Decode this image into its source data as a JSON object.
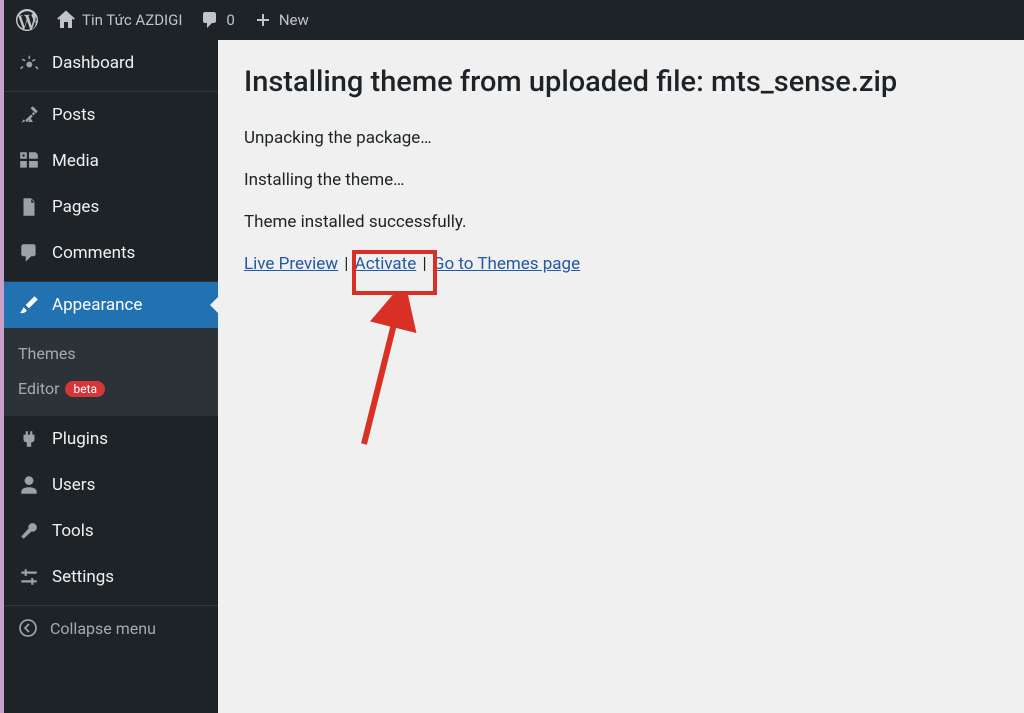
{
  "adminbar": {
    "site_name": "Tin Tức AZDIGI",
    "comments_count": "0",
    "new_label": "New"
  },
  "sidebar": {
    "dashboard": "Dashboard",
    "posts": "Posts",
    "media": "Media",
    "pages": "Pages",
    "comments": "Comments",
    "appearance": "Appearance",
    "appearance_sub": {
      "themes": "Themes",
      "editor": "Editor",
      "editor_badge": "beta"
    },
    "plugins": "Plugins",
    "users": "Users",
    "tools": "Tools",
    "settings": "Settings",
    "collapse": "Collapse menu"
  },
  "main": {
    "title": "Installing theme from uploaded file: mts_sense.zip",
    "status1": "Unpacking the package…",
    "status2": "Installing the theme…",
    "status3": "Theme installed successfully.",
    "link_preview": "Live Preview",
    "link_activate": "Activate",
    "link_themes": "Go to Themes page"
  }
}
